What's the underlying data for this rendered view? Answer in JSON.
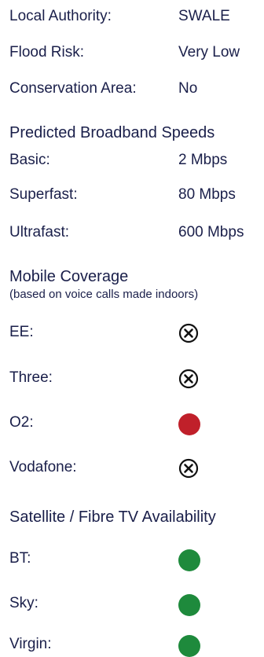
{
  "property": {
    "local_authority_label": "Local Authority:",
    "local_authority_value": "SWALE",
    "flood_risk_label": "Flood Risk:",
    "flood_risk_value": "Very Low",
    "conservation_label": "Conservation Area:",
    "conservation_value": "No"
  },
  "broadband": {
    "title": "Predicted Broadband Speeds",
    "rows": [
      {
        "label": "Basic:",
        "value": "2 Mbps"
      },
      {
        "label": "Superfast:",
        "value": "80 Mbps"
      },
      {
        "label": "Ultrafast:",
        "value": "600 Mbps"
      }
    ]
  },
  "mobile": {
    "title": "Mobile Coverage",
    "subtitle": "(based on voice calls made indoors)",
    "rows": [
      {
        "label": "EE:",
        "status": "none",
        "icon": "cross-circle-icon"
      },
      {
        "label": "Three:",
        "status": "none",
        "icon": "cross-circle-icon"
      },
      {
        "label": "O2:",
        "status": "limited",
        "icon": "red-dot-icon"
      },
      {
        "label": "Vodafone:",
        "status": "none",
        "icon": "cross-circle-icon"
      }
    ]
  },
  "tv": {
    "title": "Satellite / Fibre TV Availability",
    "rows": [
      {
        "label": "BT:",
        "status": "available",
        "icon": "green-dot-icon"
      },
      {
        "label": "Sky:",
        "status": "available",
        "icon": "green-dot-icon"
      },
      {
        "label": "Virgin:",
        "status": "available",
        "icon": "green-dot-icon"
      }
    ]
  },
  "colors": {
    "text": "#1a1f4a",
    "available": "#1e8a3c",
    "limited": "#c0202a",
    "cross": "#111111"
  }
}
